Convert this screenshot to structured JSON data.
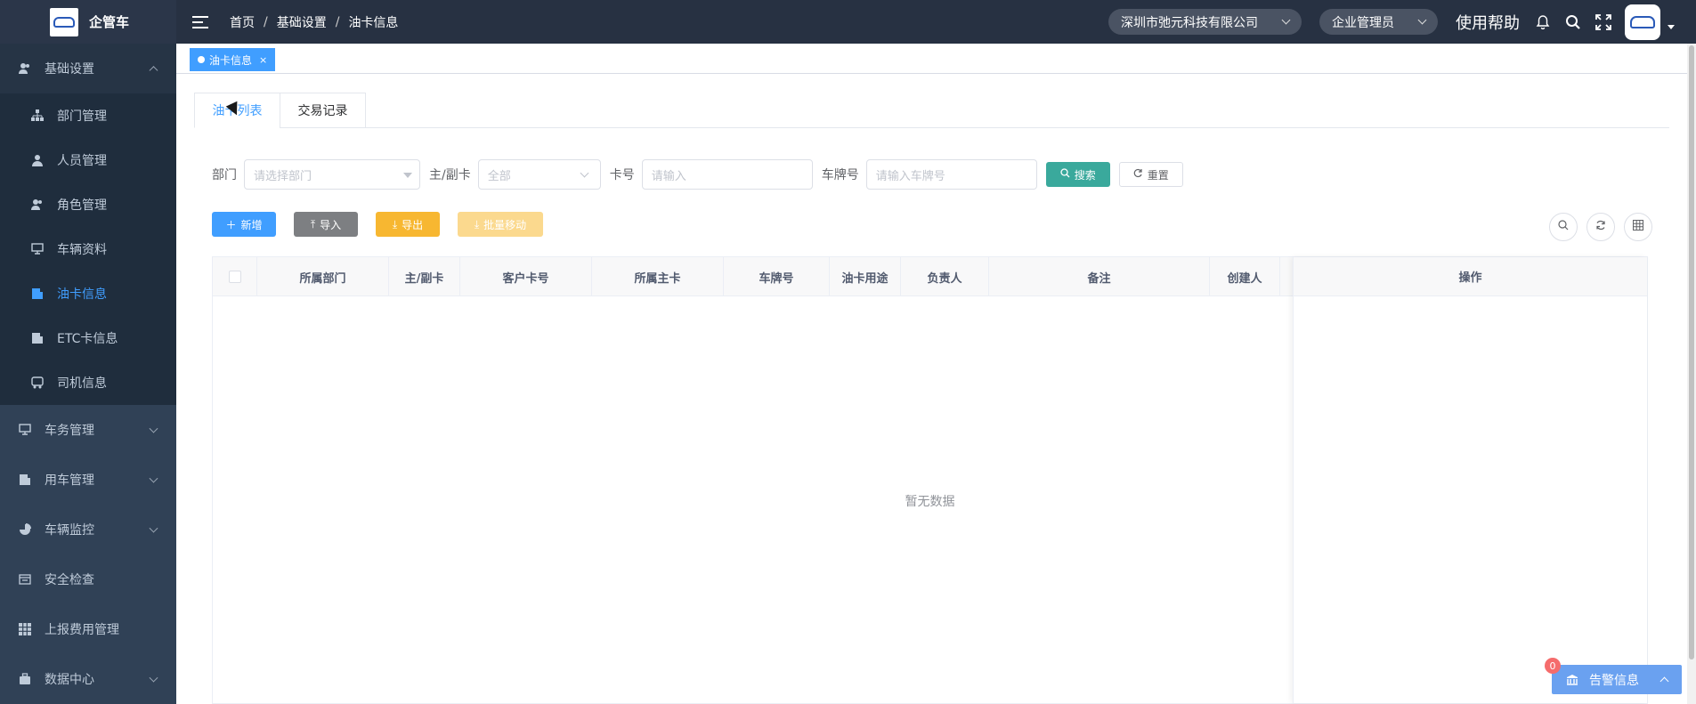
{
  "app": {
    "name": "企管车"
  },
  "header": {
    "breadcrumb": [
      "首页",
      "基础设置",
      "油卡信息"
    ],
    "company": "深圳市弛元科技有限公司",
    "role": "企业管理员",
    "help": "使用帮助"
  },
  "sidebar": {
    "groups": [
      {
        "label": "基础设置",
        "icon": "user-group-icon",
        "expanded": true,
        "items": [
          {
            "label": "部门管理",
            "icon": "org-tree-icon"
          },
          {
            "label": "人员管理",
            "icon": "person-icon"
          },
          {
            "label": "角色管理",
            "icon": "role-icon"
          },
          {
            "label": "车辆资料",
            "icon": "monitor-icon"
          },
          {
            "label": "油卡信息",
            "icon": "card-icon",
            "active": true
          },
          {
            "label": "ETC卡信息",
            "icon": "etc-card-icon"
          },
          {
            "label": "司机信息",
            "icon": "bus-icon"
          }
        ]
      },
      {
        "label": "车务管理",
        "icon": "monitor-icon"
      },
      {
        "label": "用车管理",
        "icon": "card-icon"
      },
      {
        "label": "车辆监控",
        "icon": "pie-icon"
      },
      {
        "label": "安全检查",
        "icon": "calendar-icon"
      },
      {
        "label": "上报费用管理",
        "icon": "grid-icon"
      },
      {
        "label": "数据中心",
        "icon": "briefcase-icon"
      }
    ]
  },
  "tags": [
    {
      "label": "油卡信息",
      "close": "×"
    }
  ],
  "tabs": [
    {
      "label": "油卡列表"
    },
    {
      "label": "交易记录"
    }
  ],
  "filters": {
    "dept_label": "部门",
    "dept_placeholder": "请选择部门",
    "type_label": "主/副卡",
    "type_value": "全部",
    "card_label": "卡号",
    "card_placeholder": "请输入",
    "plate_label": "车牌号",
    "plate_placeholder": "请输入车牌号",
    "search": "搜索",
    "reset": "重置"
  },
  "toolbar": {
    "add": "新增",
    "import": "导入",
    "export": "导出",
    "batch_move": "批量移动"
  },
  "table": {
    "columns": [
      "所属部门",
      "主/副卡",
      "客户卡号",
      "所属主卡",
      "车牌号",
      "油卡用途",
      "负责人",
      "备注",
      "创建人"
    ],
    "action_column": "操作",
    "empty_text": "暂无数据"
  },
  "alarm": {
    "label": "告警信息",
    "count": "0"
  },
  "colors": {
    "primary": "#409eff",
    "sidebar": "#304156",
    "topbar": "#273142",
    "success": "#3aa99c",
    "warning": "#f7b731",
    "import": "#7d7f82"
  }
}
